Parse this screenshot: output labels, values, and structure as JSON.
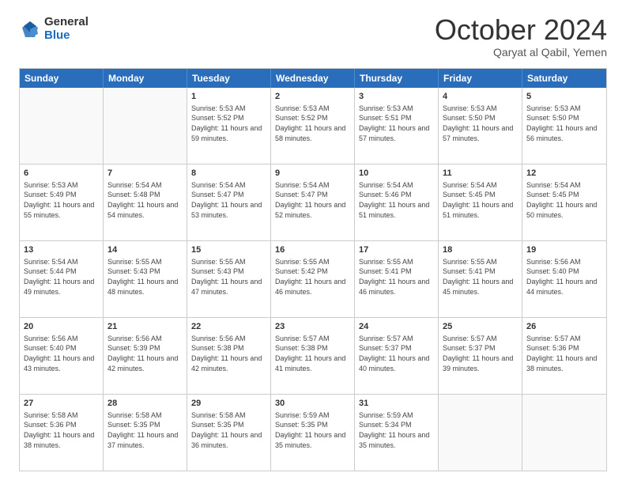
{
  "logo": {
    "general": "General",
    "blue": "Blue"
  },
  "title": "October 2024",
  "location": "Qaryat al Qabil, Yemen",
  "header_days": [
    "Sunday",
    "Monday",
    "Tuesday",
    "Wednesday",
    "Thursday",
    "Friday",
    "Saturday"
  ],
  "weeks": [
    [
      {
        "day": "",
        "info": "",
        "empty": true
      },
      {
        "day": "",
        "info": "",
        "empty": true
      },
      {
        "day": "1",
        "info": "Sunrise: 5:53 AM\nSunset: 5:52 PM\nDaylight: 11 hours and 59 minutes."
      },
      {
        "day": "2",
        "info": "Sunrise: 5:53 AM\nSunset: 5:52 PM\nDaylight: 11 hours and 58 minutes."
      },
      {
        "day": "3",
        "info": "Sunrise: 5:53 AM\nSunset: 5:51 PM\nDaylight: 11 hours and 57 minutes."
      },
      {
        "day": "4",
        "info": "Sunrise: 5:53 AM\nSunset: 5:50 PM\nDaylight: 11 hours and 57 minutes."
      },
      {
        "day": "5",
        "info": "Sunrise: 5:53 AM\nSunset: 5:50 PM\nDaylight: 11 hours and 56 minutes."
      }
    ],
    [
      {
        "day": "6",
        "info": "Sunrise: 5:53 AM\nSunset: 5:49 PM\nDaylight: 11 hours and 55 minutes."
      },
      {
        "day": "7",
        "info": "Sunrise: 5:54 AM\nSunset: 5:48 PM\nDaylight: 11 hours and 54 minutes."
      },
      {
        "day": "8",
        "info": "Sunrise: 5:54 AM\nSunset: 5:47 PM\nDaylight: 11 hours and 53 minutes."
      },
      {
        "day": "9",
        "info": "Sunrise: 5:54 AM\nSunset: 5:47 PM\nDaylight: 11 hours and 52 minutes."
      },
      {
        "day": "10",
        "info": "Sunrise: 5:54 AM\nSunset: 5:46 PM\nDaylight: 11 hours and 51 minutes."
      },
      {
        "day": "11",
        "info": "Sunrise: 5:54 AM\nSunset: 5:45 PM\nDaylight: 11 hours and 51 minutes."
      },
      {
        "day": "12",
        "info": "Sunrise: 5:54 AM\nSunset: 5:45 PM\nDaylight: 11 hours and 50 minutes."
      }
    ],
    [
      {
        "day": "13",
        "info": "Sunrise: 5:54 AM\nSunset: 5:44 PM\nDaylight: 11 hours and 49 minutes."
      },
      {
        "day": "14",
        "info": "Sunrise: 5:55 AM\nSunset: 5:43 PM\nDaylight: 11 hours and 48 minutes."
      },
      {
        "day": "15",
        "info": "Sunrise: 5:55 AM\nSunset: 5:43 PM\nDaylight: 11 hours and 47 minutes."
      },
      {
        "day": "16",
        "info": "Sunrise: 5:55 AM\nSunset: 5:42 PM\nDaylight: 11 hours and 46 minutes."
      },
      {
        "day": "17",
        "info": "Sunrise: 5:55 AM\nSunset: 5:41 PM\nDaylight: 11 hours and 46 minutes."
      },
      {
        "day": "18",
        "info": "Sunrise: 5:55 AM\nSunset: 5:41 PM\nDaylight: 11 hours and 45 minutes."
      },
      {
        "day": "19",
        "info": "Sunrise: 5:56 AM\nSunset: 5:40 PM\nDaylight: 11 hours and 44 minutes."
      }
    ],
    [
      {
        "day": "20",
        "info": "Sunrise: 5:56 AM\nSunset: 5:40 PM\nDaylight: 11 hours and 43 minutes."
      },
      {
        "day": "21",
        "info": "Sunrise: 5:56 AM\nSunset: 5:39 PM\nDaylight: 11 hours and 42 minutes."
      },
      {
        "day": "22",
        "info": "Sunrise: 5:56 AM\nSunset: 5:38 PM\nDaylight: 11 hours and 42 minutes."
      },
      {
        "day": "23",
        "info": "Sunrise: 5:57 AM\nSunset: 5:38 PM\nDaylight: 11 hours and 41 minutes."
      },
      {
        "day": "24",
        "info": "Sunrise: 5:57 AM\nSunset: 5:37 PM\nDaylight: 11 hours and 40 minutes."
      },
      {
        "day": "25",
        "info": "Sunrise: 5:57 AM\nSunset: 5:37 PM\nDaylight: 11 hours and 39 minutes."
      },
      {
        "day": "26",
        "info": "Sunrise: 5:57 AM\nSunset: 5:36 PM\nDaylight: 11 hours and 38 minutes."
      }
    ],
    [
      {
        "day": "27",
        "info": "Sunrise: 5:58 AM\nSunset: 5:36 PM\nDaylight: 11 hours and 38 minutes."
      },
      {
        "day": "28",
        "info": "Sunrise: 5:58 AM\nSunset: 5:35 PM\nDaylight: 11 hours and 37 minutes."
      },
      {
        "day": "29",
        "info": "Sunrise: 5:58 AM\nSunset: 5:35 PM\nDaylight: 11 hours and 36 minutes."
      },
      {
        "day": "30",
        "info": "Sunrise: 5:59 AM\nSunset: 5:35 PM\nDaylight: 11 hours and 35 minutes."
      },
      {
        "day": "31",
        "info": "Sunrise: 5:59 AM\nSunset: 5:34 PM\nDaylight: 11 hours and 35 minutes."
      },
      {
        "day": "",
        "info": "",
        "empty": true
      },
      {
        "day": "",
        "info": "",
        "empty": true
      }
    ]
  ]
}
